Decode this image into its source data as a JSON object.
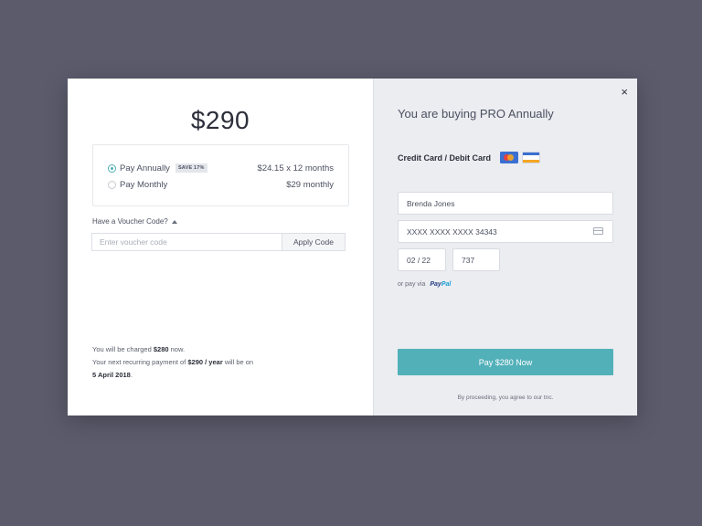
{
  "left": {
    "price": "$290",
    "plans": [
      {
        "label": "Pay Annually",
        "badge": "SAVE 17%",
        "price": "$24.15 x 12 months",
        "selected": true
      },
      {
        "label": "Pay Monthly",
        "badge": "",
        "price": "$29 monthly",
        "selected": false
      }
    ],
    "voucher": {
      "toggle_label": "Have a Voucher Code?",
      "placeholder": "Enter voucher code",
      "apply_label": "Apply Code"
    },
    "charge": {
      "line1_prefix": "You will be charged ",
      "line1_amount": "$280",
      "line1_suffix": " now.",
      "line2_prefix": "Your next recurring payment of ",
      "line2_amount": "$290 / year",
      "line2_suffix": " will be on",
      "line3_date": "5 April 2018",
      "line3_suffix": "."
    }
  },
  "right": {
    "close_label": "×",
    "buying_title": "You are buying PRO Annually",
    "card_section_title": "Credit Card / Debit Card",
    "card_icons": [
      "mastercard-icon",
      "visa-icon"
    ],
    "name_value": "Brenda Jones",
    "card_number_value": "XXXX XXXX XXXX 34343",
    "expiry_value": "02 / 22",
    "cvc_value": "737",
    "paypal_prefix": "or pay via",
    "paypal_logo_part1": "Pay",
    "paypal_logo_part2": "Pal",
    "pay_button_label": "Pay $280 Now",
    "terms": "By proceeding, you agree to our tnc."
  },
  "colors": {
    "backdrop": "#5c5b6c",
    "accent": "#52b0b9",
    "right_panel": "#ebedf1"
  }
}
